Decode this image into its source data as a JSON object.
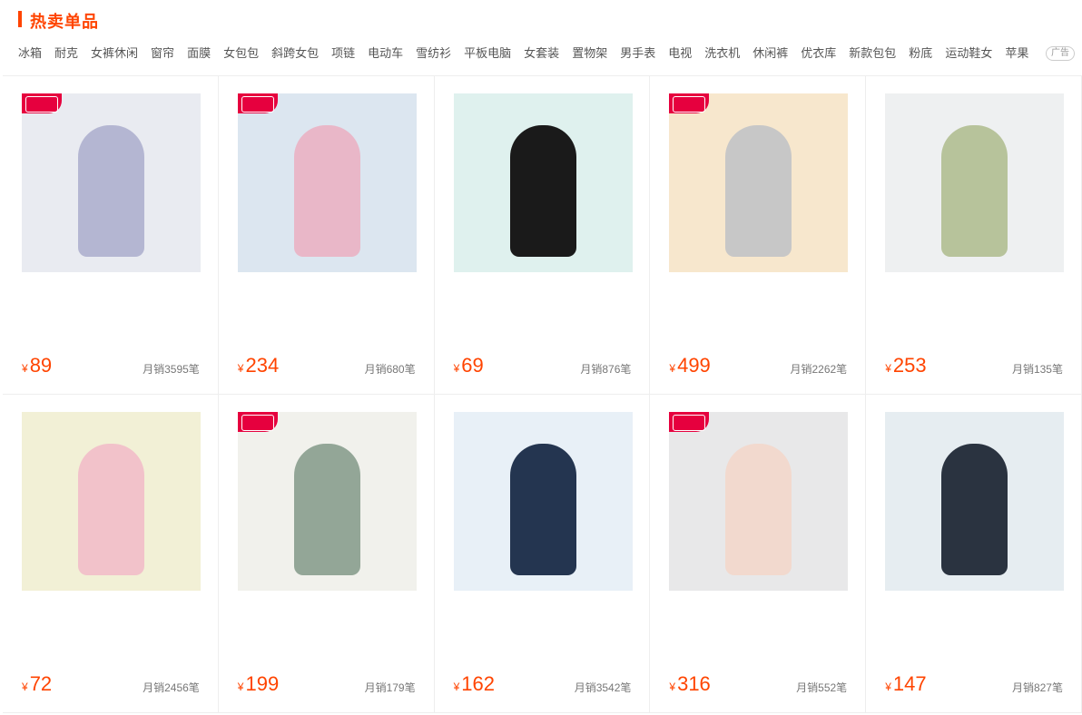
{
  "header": {
    "title": "热卖单品",
    "ad_label": "广告",
    "tags": [
      "冰箱",
      "耐克",
      "女裤休闲",
      "窗帘",
      "面膜",
      "女包包",
      "斜跨女包",
      "项链",
      "电动车",
      "雪纺衫",
      "平板电脑",
      "女套装",
      "置物架",
      "男手表",
      "电视",
      "洗衣机",
      "休闲裤",
      "优衣库",
      "新款包包",
      "粉底",
      "运动鞋女",
      "苹果"
    ]
  },
  "products": [
    {
      "price": "89",
      "sales": "月销3595笔",
      "badge": true,
      "colors": {
        "bg": "#e9ebf1",
        "fg": "#b4b6d2"
      }
    },
    {
      "price": "234",
      "sales": "月销680笔",
      "badge": true,
      "colors": {
        "bg": "#dce6f0",
        "fg": "#e9b7c8"
      }
    },
    {
      "price": "69",
      "sales": "月销876笔",
      "badge": false,
      "colors": {
        "bg": "#dff1ee",
        "fg": "#1a1a1a"
      }
    },
    {
      "price": "499",
      "sales": "月销2262笔",
      "badge": true,
      "colors": {
        "bg": "#f7e7cd",
        "fg": "#c7c7c7"
      }
    },
    {
      "price": "253",
      "sales": "月销135笔",
      "badge": false,
      "colors": {
        "bg": "#eef0f1",
        "fg": "#b7c39b"
      }
    },
    {
      "price": "72",
      "sales": "月销2456笔",
      "badge": false,
      "colors": {
        "bg": "#f2f0d6",
        "fg": "#f2c2ca"
      }
    },
    {
      "price": "199",
      "sales": "月销179笔",
      "badge": true,
      "colors": {
        "bg": "#f1f1ec",
        "fg": "#93a697"
      }
    },
    {
      "price": "162",
      "sales": "月销3542笔",
      "badge": false,
      "colors": {
        "bg": "#e8f0f7",
        "fg": "#243550"
      }
    },
    {
      "price": "316",
      "sales": "月销552笔",
      "badge": true,
      "colors": {
        "bg": "#e8e8e9",
        "fg": "#f2d9ce"
      }
    },
    {
      "price": "147",
      "sales": "月销827笔",
      "badge": false,
      "colors": {
        "bg": "#e6edf1",
        "fg": "#2a3340"
      }
    }
  ]
}
